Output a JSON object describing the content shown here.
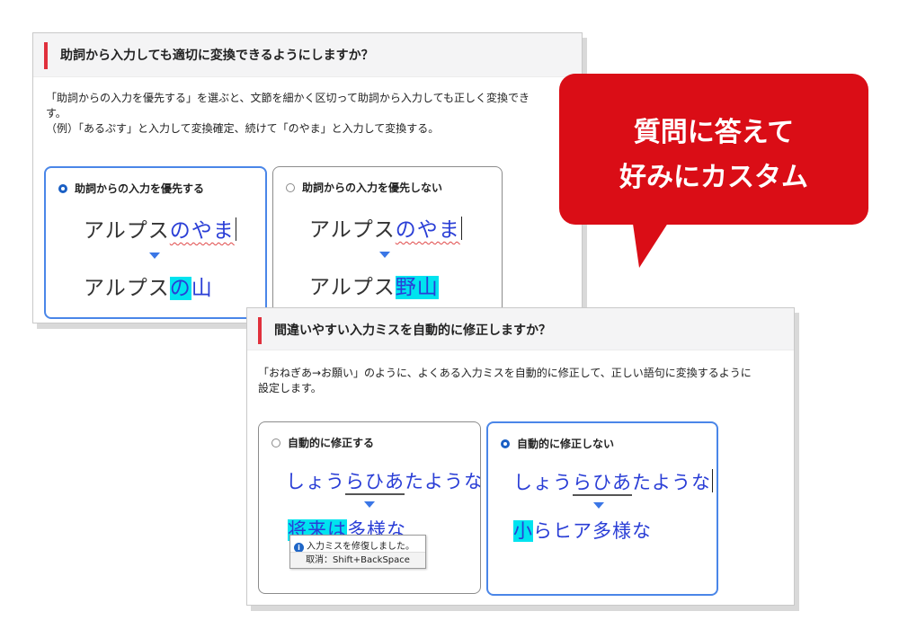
{
  "panel1": {
    "title": "助詞から入力しても適切に変換できるようにしますか？",
    "desc_line1": "「助詞からの入力を優先する」を選ぶと、文節を細かく区切って助詞から入力しても正しく変換でき",
    "desc_line2": "す。",
    "desc_line3": "（例）「あるぷす」と入力して変換確定、続けて「のやま」と入力して変換する。",
    "option_a": {
      "label": "助詞からの入力を優先する",
      "selected": true,
      "input_prefix": "アルプス",
      "input_kana": "のやま",
      "result_prefix": "アルプス",
      "result_hl": "の",
      "result_rest": "山"
    },
    "option_b": {
      "label": "助詞からの入力を優先しない",
      "selected": false,
      "input_prefix": "アルプス",
      "input_kana": "のやま",
      "result_prefix": "アルプス",
      "result_hl": "野山"
    }
  },
  "panel2": {
    "title": "間違いやすい入力ミスを自動的に修正しますか？",
    "desc_line1": "「おねぎあ→お願い」のように、よくある入力ミスを自動的に修正して、正しい語句に変換するように",
    "desc_line2": "設定します。",
    "option_a": {
      "label": "自動的に修正する",
      "selected": false,
      "input_a": "しょう",
      "input_b": "らひあ",
      "input_c": "たような",
      "result_hl": "将来は",
      "result_rest": "多様な",
      "tooltip_line1": "入力ミスを修復しました。",
      "tooltip_line2": "取消：Shift+BackSpace"
    },
    "option_b": {
      "label": "自動的に修正しない",
      "selected": true,
      "input_a": "しょう",
      "input_b": "らひあ",
      "input_c": "たような",
      "result_hl": "小",
      "result_rest": "らヒア多様な"
    }
  },
  "callout": {
    "line1": "質問に答えて",
    "line2": "好みにカスタム",
    "color": "#da0d16"
  },
  "colors": {
    "accent_bar": "#e0303c",
    "selected_border": "#4a86e8",
    "highlight": "#00e3ef",
    "kana_blue": "#2a3ed6"
  },
  "icons": {
    "info": "i"
  }
}
